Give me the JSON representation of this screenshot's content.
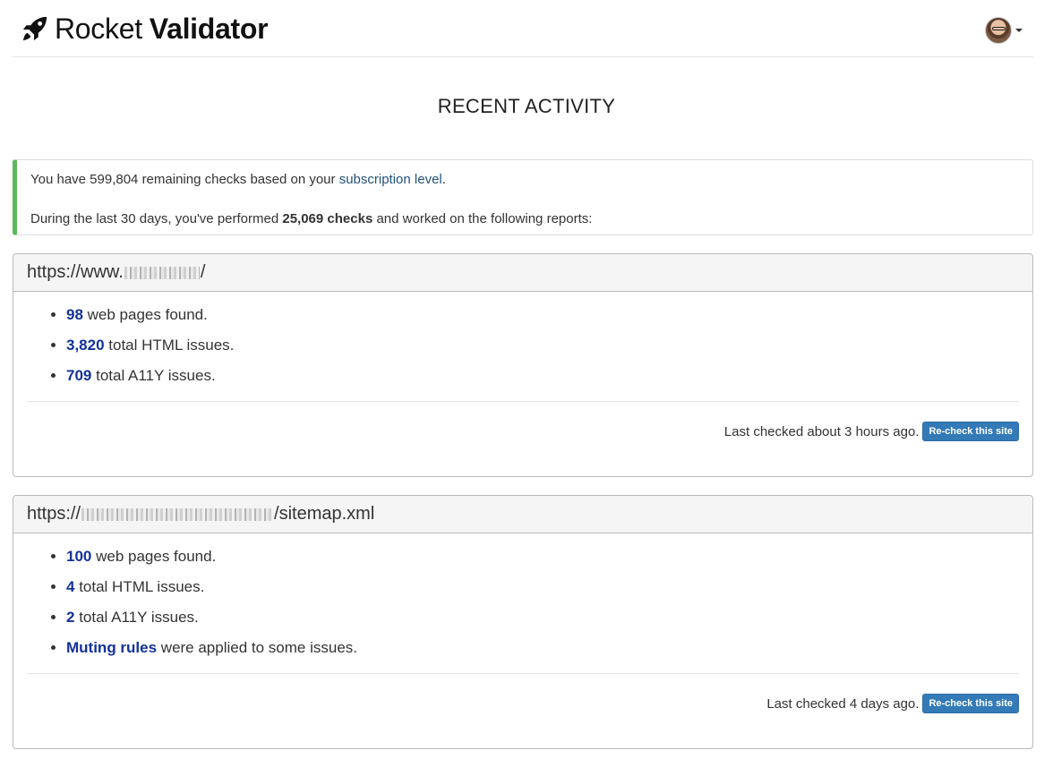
{
  "header": {
    "brand_light": "Rocket",
    "brand_bold": "Validator"
  },
  "page": {
    "title": "RECENT ACTIVITY"
  },
  "info": {
    "remaining_prefix": "You have 599,804 remaining checks based on your ",
    "subscription_link": "subscription level",
    "remaining_suffix": ".",
    "activity_prefix": "During the last 30 days, you've performed ",
    "checks_count": "25,069 checks",
    "activity_suffix": " and worked on the following reports:"
  },
  "reports": [
    {
      "url_prefix": "https://www.",
      "url_suffix": "/",
      "stats": [
        {
          "value": "98",
          "text": " web pages found."
        },
        {
          "value": "3,820",
          "text": " total HTML issues."
        },
        {
          "value": "709",
          "text": " total A11Y issues."
        }
      ],
      "last_checked": "Last checked about 3 hours ago.",
      "button": "Re-check this site"
    },
    {
      "url_prefix": "https://",
      "url_suffix": "/sitemap.xml",
      "stats": [
        {
          "value": "100",
          "text": " web pages found."
        },
        {
          "value": "4",
          "text": " total HTML issues."
        },
        {
          "value": "2",
          "text": " total A11Y issues."
        },
        {
          "value": "Muting rules",
          "text": " were applied to some issues."
        }
      ],
      "last_checked": "Last checked 4 days ago.",
      "button": "Re-check this site"
    }
  ],
  "colors": {
    "accent_green": "#5cb85c",
    "link_blue": "#23527c",
    "stat_blue": "#12329a",
    "button_blue": "#337ab7"
  },
  "icons": [
    "rocket-icon",
    "avatar",
    "caret-down-icon"
  ]
}
